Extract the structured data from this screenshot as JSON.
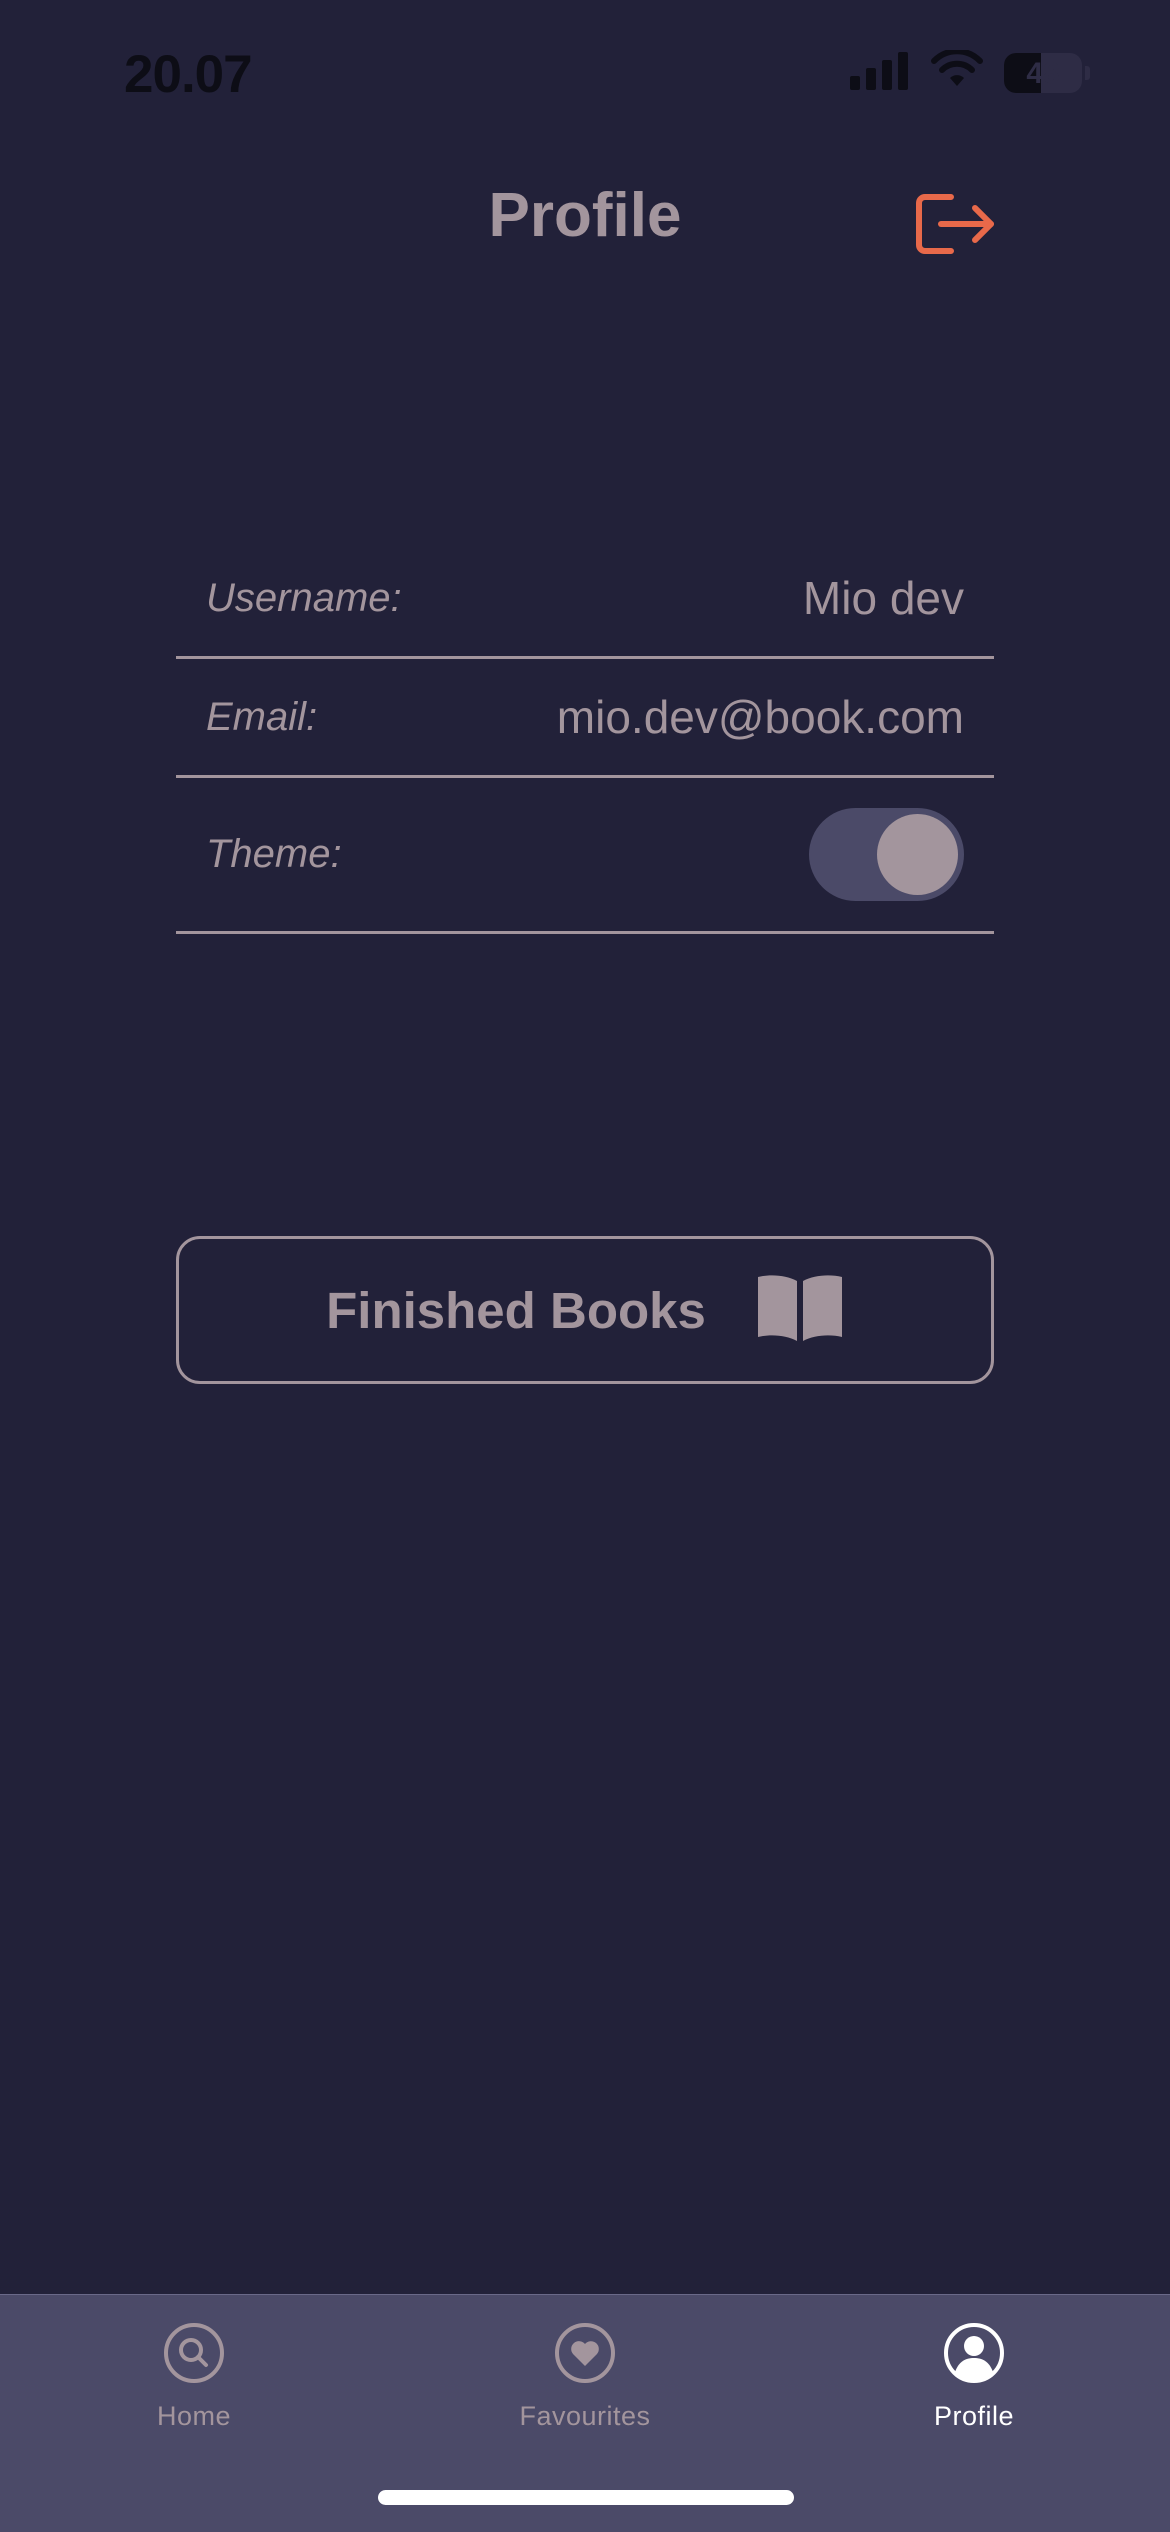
{
  "status_bar": {
    "time": "20.07",
    "battery_level": "48",
    "icons": [
      "cellular-signal-icon",
      "wifi-icon",
      "battery-icon"
    ]
  },
  "header": {
    "title": "Profile",
    "logout_icon": "logout-icon"
  },
  "profile": {
    "username_label": "Username:",
    "username_value": "Mio dev",
    "email_label": "Email:",
    "email_value": "mio.dev@book.com",
    "theme_label": "Theme:",
    "theme_toggle_on": true
  },
  "finished_books": {
    "label": "Finished Books",
    "icon": "open-book-icon"
  },
  "tab_bar": {
    "tabs": [
      {
        "label": "Home",
        "icon": "search-icon",
        "active": false
      },
      {
        "label": "Favourites",
        "icon": "heart-icon",
        "active": false
      },
      {
        "label": "Profile",
        "icon": "user-circle-icon",
        "active": true
      }
    ]
  },
  "colors": {
    "background": "#222139",
    "text_muted": "#a3959d",
    "accent": "#e8694a",
    "tab_bar": "#4b4a68",
    "active_tab": "#ffffff"
  }
}
